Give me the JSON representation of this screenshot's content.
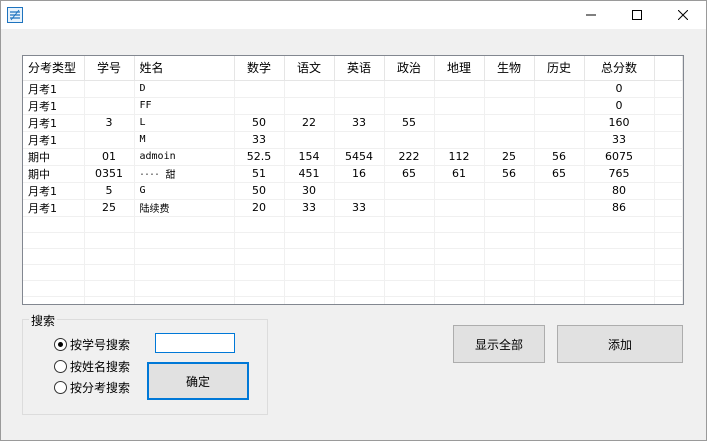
{
  "grid": {
    "columns": [
      "分考类型",
      "学号",
      "姓名",
      "数学",
      "语文",
      "英语",
      "政治",
      "地理",
      "生物",
      "历史",
      "总分数"
    ],
    "rows": [
      [
        "月考1",
        "",
        "D",
        "",
        "",
        "",
        "",
        "",
        "",
        "",
        "0"
      ],
      [
        "月考1",
        "",
        "FF",
        "",
        "",
        "",
        "",
        "",
        "",
        "",
        "0"
      ],
      [
        "月考1",
        "3",
        "L",
        "50",
        "22",
        "33",
        "55",
        "",
        "",
        "",
        "160"
      ],
      [
        "月考1",
        "",
        "M",
        "33",
        "",
        "",
        "",
        "",
        "",
        "",
        "33"
      ],
      [
        "期中",
        "01",
        "admoin",
        "52.5",
        "154",
        "5454",
        "222",
        "112",
        "25",
        "56",
        "6075"
      ],
      [
        "期中",
        "0351",
        "‥‥ 甜",
        "51",
        "451",
        "16",
        "65",
        "61",
        "56",
        "65",
        "765"
      ],
      [
        "月考1",
        "5",
        "G",
        "50",
        "30",
        "",
        "",
        "",
        "",
        "",
        "80"
      ],
      [
        "月考1",
        "25",
        "陆续费",
        "20",
        "33",
        "33",
        "",
        "",
        "",
        "",
        "86"
      ]
    ],
    "empty_rows": 6
  },
  "search": {
    "group_title": "搜索",
    "options": [
      "按学号搜索",
      "按姓名搜索",
      "按分考搜索"
    ],
    "selected_index": 0,
    "input_value": "",
    "ok_label": "确定"
  },
  "actions": {
    "show_all_label": "显示全部",
    "add_label": "添加"
  },
  "icons": {
    "app": "app-icon",
    "minimize": "minimize-icon",
    "maximize": "maximize-icon",
    "close": "close-icon"
  }
}
